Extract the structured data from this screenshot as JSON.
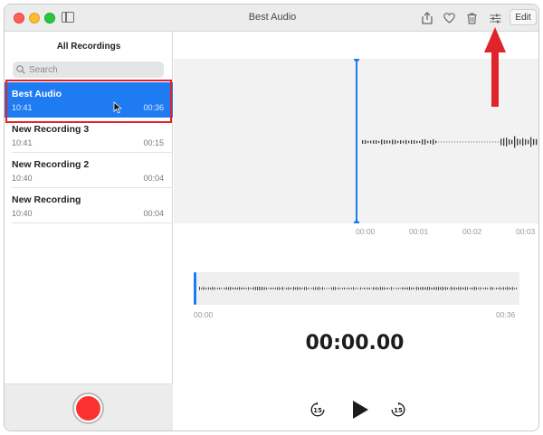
{
  "window": {
    "title": "Best Audio",
    "edit_label": "Edit"
  },
  "toolbar": {
    "icons": [
      "share-icon",
      "heart-icon",
      "trash-icon",
      "settings-sliders-icon"
    ]
  },
  "sidebar": {
    "title": "All Recordings",
    "search_placeholder": "Search",
    "recordings": [
      {
        "name": "Best Audio",
        "time": "10:41",
        "duration": "00:36",
        "selected": true
      },
      {
        "name": "New Recording 3",
        "time": "10:41",
        "duration": "00:15",
        "selected": false
      },
      {
        "name": "New Recording 2",
        "time": "10:40",
        "duration": "00:04",
        "selected": false
      },
      {
        "name": "New Recording",
        "time": "10:40",
        "duration": "00:04",
        "selected": false
      }
    ]
  },
  "waveform": {
    "ticks": [
      "00:00",
      "00:01",
      "00:02",
      "00:03"
    ]
  },
  "overview": {
    "start": "00:00",
    "end": "00:36"
  },
  "player": {
    "current_time": "00:00.00",
    "skip_back_label": "15",
    "skip_forward_label": "15"
  },
  "colors": {
    "accent": "#1e7bf2",
    "record": "#fb3132",
    "annotation": "#e0242b"
  }
}
